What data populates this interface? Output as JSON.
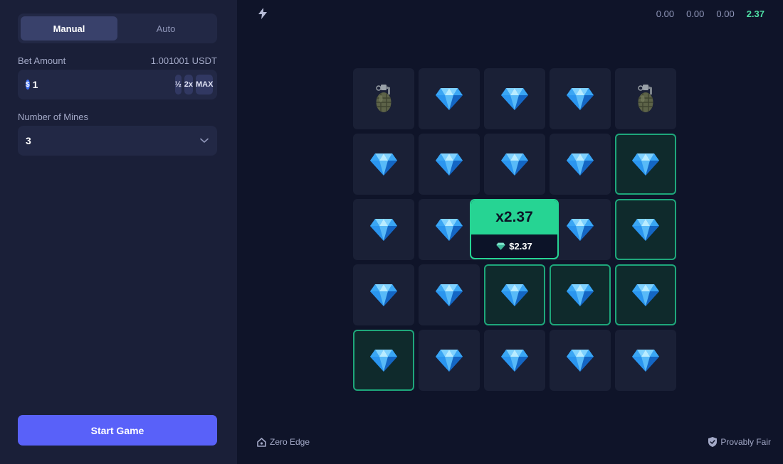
{
  "sidebar": {
    "tabs": [
      {
        "label": "Manual",
        "active": true
      },
      {
        "label": "Auto",
        "active": false
      }
    ],
    "bet": {
      "label": "Bet Amount",
      "balance": "1.001001 USDT",
      "currency_symbol": "$",
      "value": "1",
      "half_label": "½",
      "double_label": "2x",
      "max_label": "MAX"
    },
    "mines": {
      "label": "Number of Mines",
      "value": "3"
    },
    "start_label": "Start Game"
  },
  "header": {
    "icon": "lightning-icon",
    "stats": [
      "0.00",
      "0.00",
      "0.00",
      "2.37"
    ],
    "highlight_index": 3,
    "highlight_color": "#4fe0a5"
  },
  "board": {
    "rows": 5,
    "cols": 5,
    "tiles": [
      [
        "grenade",
        "gem",
        "gem",
        "gem",
        "grenade"
      ],
      [
        "gem",
        "gem",
        "gem",
        "gem",
        "gem"
      ],
      [
        "gem",
        "gem",
        "gem",
        "gem",
        "gem"
      ],
      [
        "gem",
        "gem",
        "gem",
        "gem",
        "gem"
      ],
      [
        "gem",
        "gem",
        "gem",
        "gem",
        "gem"
      ]
    ],
    "picked": [
      [
        1,
        4
      ],
      [
        2,
        4
      ],
      [
        3,
        2
      ],
      [
        3,
        3
      ],
      [
        3,
        4
      ],
      [
        4,
        0
      ]
    ]
  },
  "win_popup": {
    "multiplier": "x2.37",
    "payout": "$2.37"
  },
  "footer": {
    "left_label": "Zero Edge",
    "right_label": "Provably Fair"
  },
  "colors": {
    "accent": "#5961f9",
    "win": "#26d493",
    "picked_border": "#1ea77b",
    "background": "#0f1429",
    "sidebar": "#1a1f38"
  }
}
